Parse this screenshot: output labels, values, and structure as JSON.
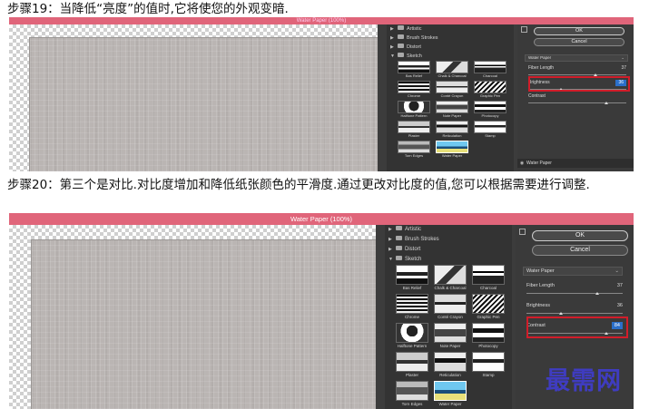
{
  "steps": {
    "step19": "步骤19：当降低“亮度”的值时,它将使您的外观变暗.",
    "step20": "步骤20：第三个是对比.对比度增加和降低纸张颜色的平滑度.通过更改对比度的值,您可以根据需要进行调整."
  },
  "dialog": {
    "title": "Water Paper (100%)",
    "ok_label": "OK",
    "cancel_label": "Cancel",
    "categories": [
      "Artistic",
      "Brush Strokes",
      "Distort",
      "Sketch"
    ],
    "thumbnails": [
      "Bas Relief",
      "Chalk & Charcoal",
      "Charcoal",
      "Chrome",
      "Conté Crayon",
      "Graphic Pen",
      "Halftone Pattern",
      "Note Paper",
      "Photocopy",
      "Plaster",
      "Reticulation",
      "Stamp",
      "Torn Edges",
      "Water Paper"
    ],
    "selected_filter": "Water Paper",
    "fiber_length_label": "Fiber Length",
    "brightness_label": "Brightness",
    "contrast_label": "Contrast",
    "layer_name": "Water Paper"
  },
  "shot1": {
    "fiber_length": "37",
    "brightness": "36",
    "contrast": ""
  },
  "shot2": {
    "fiber_length": "37",
    "brightness": "36",
    "contrast": "84"
  },
  "watermark": "最需网",
  "colors": {
    "title_bar": "#e0657a",
    "highlight_box": "#d11d2a",
    "watermark": "#3f3cc0"
  }
}
